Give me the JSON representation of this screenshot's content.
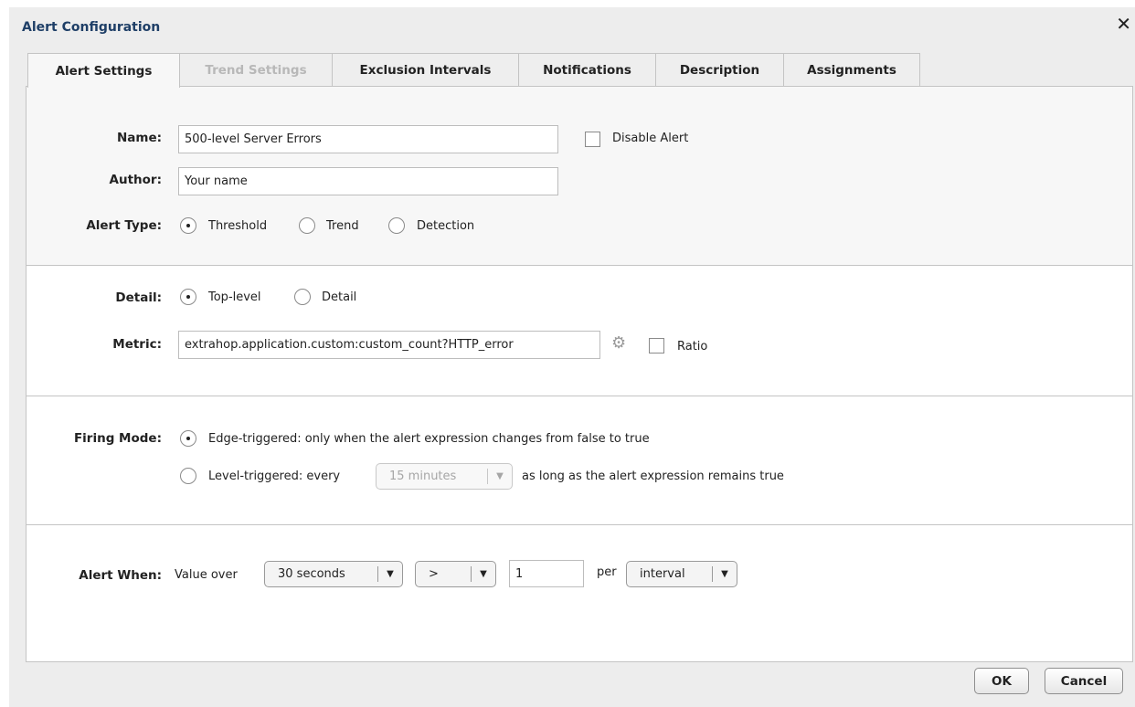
{
  "dialog": {
    "title": "Alert Configuration"
  },
  "tabs": [
    {
      "label": "Alert Settings"
    },
    {
      "label": "Trend Settings"
    },
    {
      "label": "Exclusion Intervals"
    },
    {
      "label": "Notifications"
    },
    {
      "label": "Description"
    },
    {
      "label": "Assignments"
    }
  ],
  "general": {
    "name_label": "Name:",
    "name_value": "500-level Server Errors",
    "disable_label": "Disable Alert",
    "author_label": "Author:",
    "author_value": "Your name",
    "alert_type_label": "Alert Type:",
    "types": [
      {
        "label": "Threshold"
      },
      {
        "label": "Trend"
      },
      {
        "label": "Detection"
      }
    ]
  },
  "detail": {
    "label": "Detail:",
    "options": [
      {
        "label": "Top-level"
      },
      {
        "label": "Detail"
      }
    ],
    "metric_label": "Metric:",
    "metric_value": "extrahop.application.custom:custom_count?HTTP_error",
    "ratio_label": "Ratio"
  },
  "firing": {
    "label": "Firing Mode:",
    "edge_label": "Edge-triggered: only when the alert expression changes from false to true",
    "level_prefix": "Level-triggered: every",
    "level_interval": "15 minutes",
    "level_suffix": "as long as the alert expression remains true"
  },
  "alert_when": {
    "label": "Alert When:",
    "value_over": "Value over",
    "period": "30 seconds",
    "operator": ">",
    "threshold": "1",
    "per": "per",
    "unit": "interval"
  },
  "buttons": {
    "ok": "OK",
    "cancel": "Cancel"
  }
}
